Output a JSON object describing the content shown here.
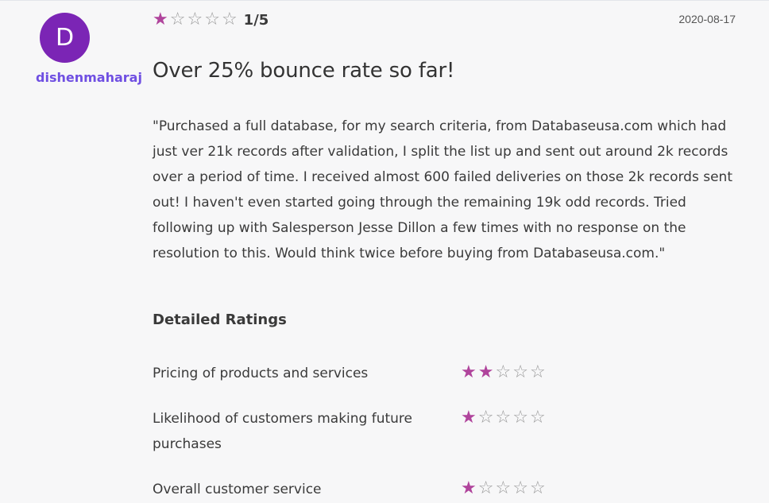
{
  "review": {
    "avatar_letter": "D",
    "username": "dishenmaharaj",
    "rating": 1,
    "rating_max": 5,
    "rating_text": "1/5",
    "date": "2020-08-17",
    "title": "Over 25% bounce rate so far!",
    "body": "\"Purchased a full database, for my search criteria, from Databaseusa.com which had just ver 21k records after validation, I split the list up and sent out around 2k records over a period of time. I received almost 600 failed deliveries on those 2k records sent out! I haven't even started going through the remaining 19k odd records. Tried following up with Salesperson Jesse Dillon a few times with no response on the resolution to this. Would think twice before buying from Databaseusa.com.\""
  },
  "detailed_ratings": {
    "heading": "Detailed Ratings",
    "items": [
      {
        "label": "Pricing of products and services",
        "rating": 2
      },
      {
        "label": "Likelihood of customers making future purchases",
        "rating": 1
      },
      {
        "label": "Overall customer service",
        "rating": 1
      }
    ]
  },
  "colors": {
    "star_filled": "#b0449c",
    "avatar_bg": "#7b25b5",
    "username": "#6f4fe2"
  },
  "icons": {
    "star_filled": "star-filled-icon",
    "star_empty": "star-empty-icon"
  }
}
